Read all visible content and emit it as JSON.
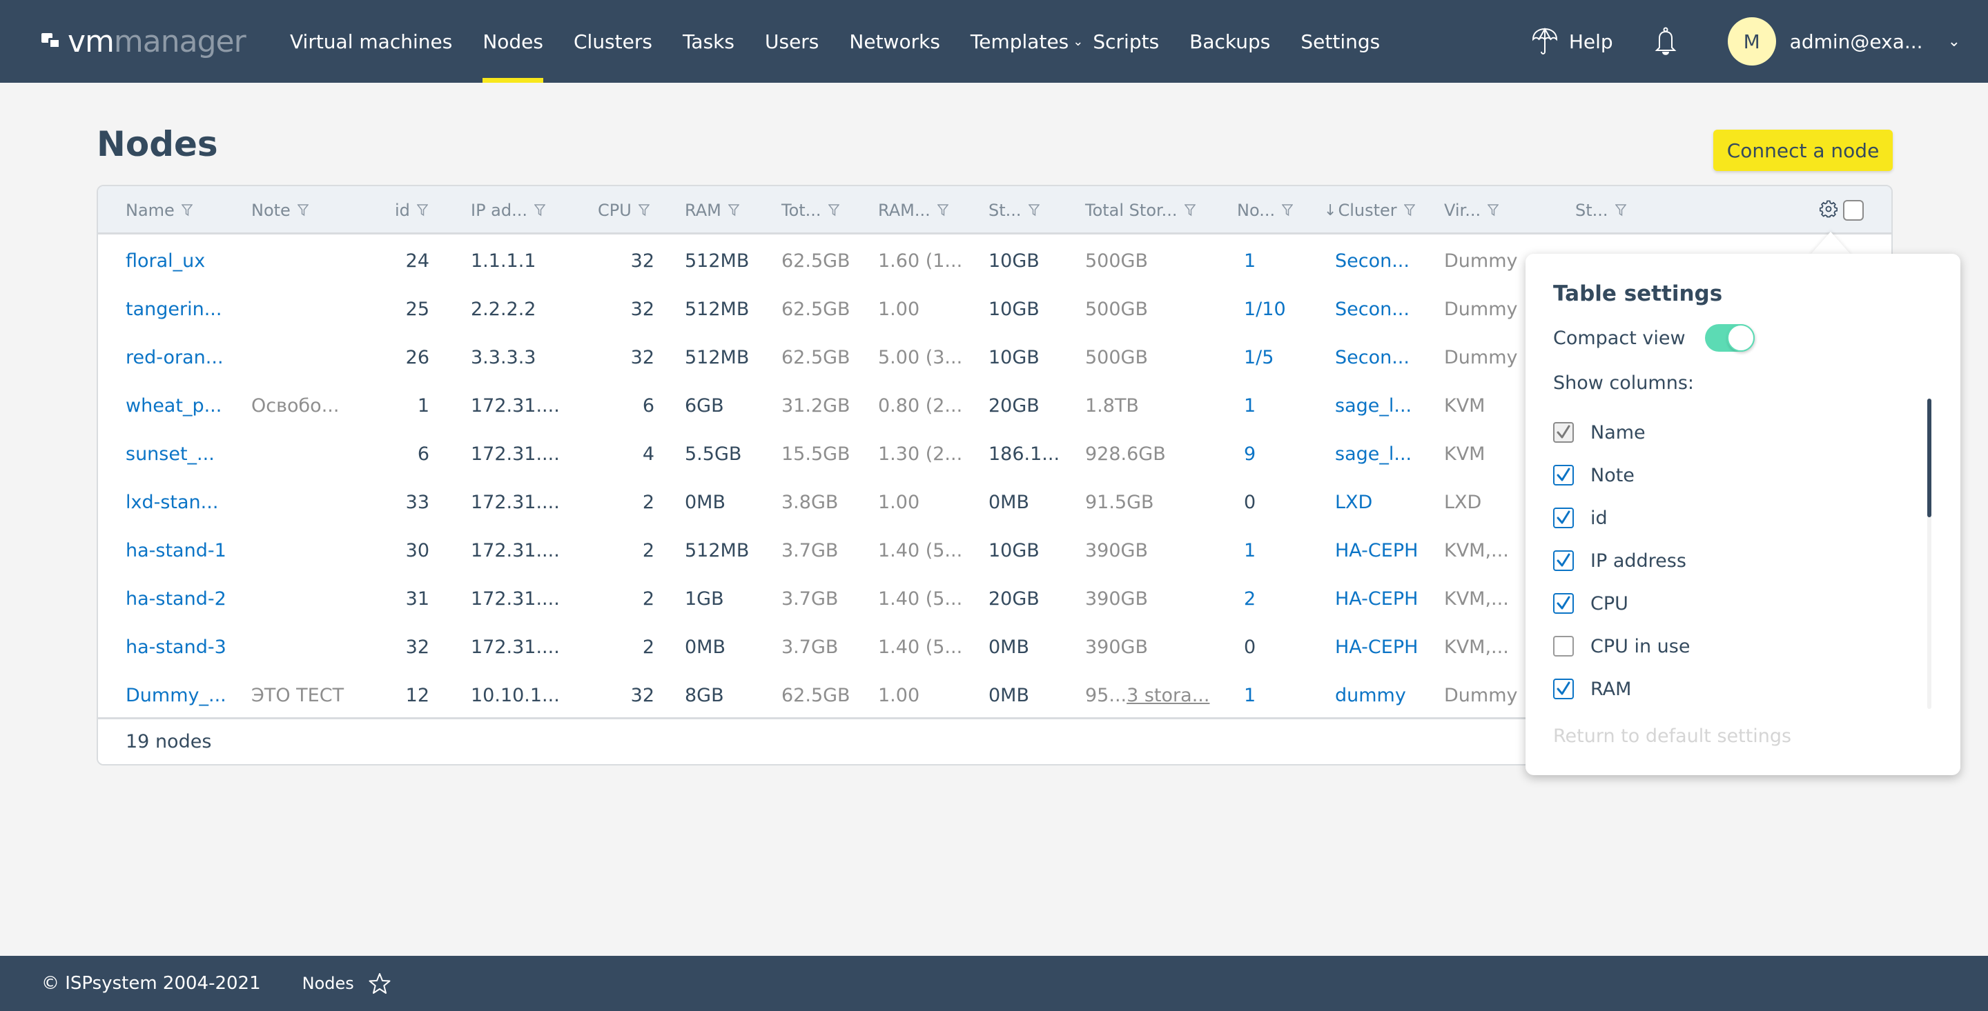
{
  "app": {
    "logo_primary": "vm",
    "logo_secondary": "manager"
  },
  "nav": {
    "items": [
      {
        "label": "Virtual machines",
        "active": false
      },
      {
        "label": "Nodes",
        "active": true
      },
      {
        "label": "Clusters",
        "active": false
      },
      {
        "label": "Tasks",
        "active": false
      },
      {
        "label": "Users",
        "active": false
      },
      {
        "label": "Networks",
        "active": false
      },
      {
        "label": "Templates",
        "active": false,
        "dropdown": true
      },
      {
        "label": "Scripts",
        "active": false
      },
      {
        "label": "Backups",
        "active": false
      },
      {
        "label": "Settings",
        "active": false
      }
    ],
    "help_label": "Help",
    "help_icon": "umbrella-icon",
    "notifications_icon": "bell-icon",
    "avatar_letter": "M",
    "user_name": "admin@exa...",
    "accent_color": "#f8e71c"
  },
  "page": {
    "title": "Nodes",
    "connect_button": "Connect a node"
  },
  "table": {
    "columns": [
      {
        "key": "name",
        "label": "Name"
      },
      {
        "key": "note",
        "label": "Note"
      },
      {
        "key": "id",
        "label": "id"
      },
      {
        "key": "ip",
        "label": "IP ad..."
      },
      {
        "key": "cpu",
        "label": "CPU"
      },
      {
        "key": "ram",
        "label": "RAM"
      },
      {
        "key": "total_ram",
        "label": "Tot..."
      },
      {
        "key": "ram_ratio",
        "label": "RAM..."
      },
      {
        "key": "storage",
        "label": "St..."
      },
      {
        "key": "total_storage",
        "label": "Total Stor..."
      },
      {
        "key": "vms",
        "label": "No..."
      },
      {
        "key": "cluster",
        "label": "Cluster",
        "sort": "↓"
      },
      {
        "key": "virt",
        "label": "Vir..."
      },
      {
        "key": "status",
        "label": "St..."
      }
    ],
    "rows": [
      {
        "name": "floral_ux",
        "note": "",
        "id": "24",
        "ip": "1.1.1.1",
        "cpu": "32",
        "ram": "512MB",
        "total_ram": "62.5GB",
        "ram_ratio": "1.60 (1...",
        "storage": "10GB",
        "total_storage": "500GB",
        "total_storage_link": "",
        "vms": "1",
        "cluster": "Secon...",
        "virt": "Dummy"
      },
      {
        "name": "tangerin...",
        "note": "",
        "id": "25",
        "ip": "2.2.2.2",
        "cpu": "32",
        "ram": "512MB",
        "total_ram": "62.5GB",
        "ram_ratio": "1.00",
        "storage": "10GB",
        "total_storage": "500GB",
        "total_storage_link": "",
        "vms": "1/10",
        "cluster": "Secon...",
        "virt": "Dummy"
      },
      {
        "name": "red-oran...",
        "note": "",
        "id": "26",
        "ip": "3.3.3.3",
        "cpu": "32",
        "ram": "512MB",
        "total_ram": "62.5GB",
        "ram_ratio": "5.00 (3...",
        "storage": "10GB",
        "total_storage": "500GB",
        "total_storage_link": "",
        "vms": "1/5",
        "cluster": "Secon...",
        "virt": "Dummy"
      },
      {
        "name": "wheat_p...",
        "note": "Освобо...",
        "id": "1",
        "ip": "172.31....",
        "cpu": "6",
        "ram": "6GB",
        "total_ram": "31.2GB",
        "ram_ratio": "0.80 (2...",
        "storage": "20GB",
        "total_storage": "1.8TB",
        "total_storage_link": "",
        "vms": "1",
        "cluster": "sage_l...",
        "virt": "KVM"
      },
      {
        "name": "sunset_...",
        "note": "",
        "id": "6",
        "ip": "172.31....",
        "cpu": "4",
        "ram": "5.5GB",
        "total_ram": "15.5GB",
        "ram_ratio": "1.30 (2...",
        "storage": "186.1...",
        "total_storage": "928.6GB",
        "total_storage_link": "",
        "vms": "9",
        "cluster": "sage_l...",
        "virt": "KVM"
      },
      {
        "name": "lxd-stan...",
        "note": "",
        "id": "33",
        "ip": "172.31....",
        "cpu": "2",
        "ram": "0MB",
        "total_ram": "3.8GB",
        "ram_ratio": "1.00",
        "storage": "0MB",
        "total_storage": "91.5GB",
        "total_storage_link": "",
        "vms": "0",
        "cluster": "LXD",
        "virt": "LXD"
      },
      {
        "name": "ha-stand-1",
        "note": "",
        "id": "30",
        "ip": "172.31....",
        "cpu": "2",
        "ram": "512MB",
        "total_ram": "3.7GB",
        "ram_ratio": "1.40 (5...",
        "storage": "10GB",
        "total_storage": "390GB",
        "total_storage_link": "",
        "vms": "1",
        "cluster": "HA-CEPH",
        "virt": "KVM,..."
      },
      {
        "name": "ha-stand-2",
        "note": "",
        "id": "31",
        "ip": "172.31....",
        "cpu": "2",
        "ram": "1GB",
        "total_ram": "3.7GB",
        "ram_ratio": "1.40 (5...",
        "storage": "20GB",
        "total_storage": "390GB",
        "total_storage_link": "",
        "vms": "2",
        "cluster": "HA-CEPH",
        "virt": "KVM,..."
      },
      {
        "name": "ha-stand-3",
        "note": "",
        "id": "32",
        "ip": "172.31....",
        "cpu": "2",
        "ram": "0MB",
        "total_ram": "3.7GB",
        "ram_ratio": "1.40 (5...",
        "storage": "0MB",
        "total_storage": "390GB",
        "total_storage_link": "",
        "vms": "0",
        "cluster": "HA-CEPH",
        "virt": "KVM,..."
      },
      {
        "name": "Dummy_...",
        "note": "ЭТО ТЕСТ",
        "id": "12",
        "ip": "10.10.1...",
        "cpu": "32",
        "ram": "8GB",
        "total_ram": "62.5GB",
        "ram_ratio": "1.00",
        "storage": "0MB",
        "total_storage": "95...",
        "total_storage_link": "3 stora...",
        "vms": "1",
        "cluster": "dummy",
        "virt": "Dummy"
      }
    ],
    "footer_count": "19 nodes"
  },
  "table_settings": {
    "title": "Table settings",
    "compact_view_label": "Compact view",
    "compact_view_on": true,
    "show_columns_label": "Show columns:",
    "columns": [
      {
        "label": "Name",
        "checked": true,
        "disabled": true
      },
      {
        "label": "Note",
        "checked": true,
        "disabled": false
      },
      {
        "label": "id",
        "checked": true,
        "disabled": false
      },
      {
        "label": "IP address",
        "checked": true,
        "disabled": false
      },
      {
        "label": "CPU",
        "checked": true,
        "disabled": false
      },
      {
        "label": "CPU in use",
        "checked": false,
        "disabled": false
      },
      {
        "label": "RAM",
        "checked": true,
        "disabled": false
      }
    ],
    "return_default_label": "Return to default settings",
    "toggle_color": "#5cdbb4"
  },
  "footer": {
    "copyright": "© ISPsystem 2004-2021",
    "current_page": "Nodes"
  }
}
